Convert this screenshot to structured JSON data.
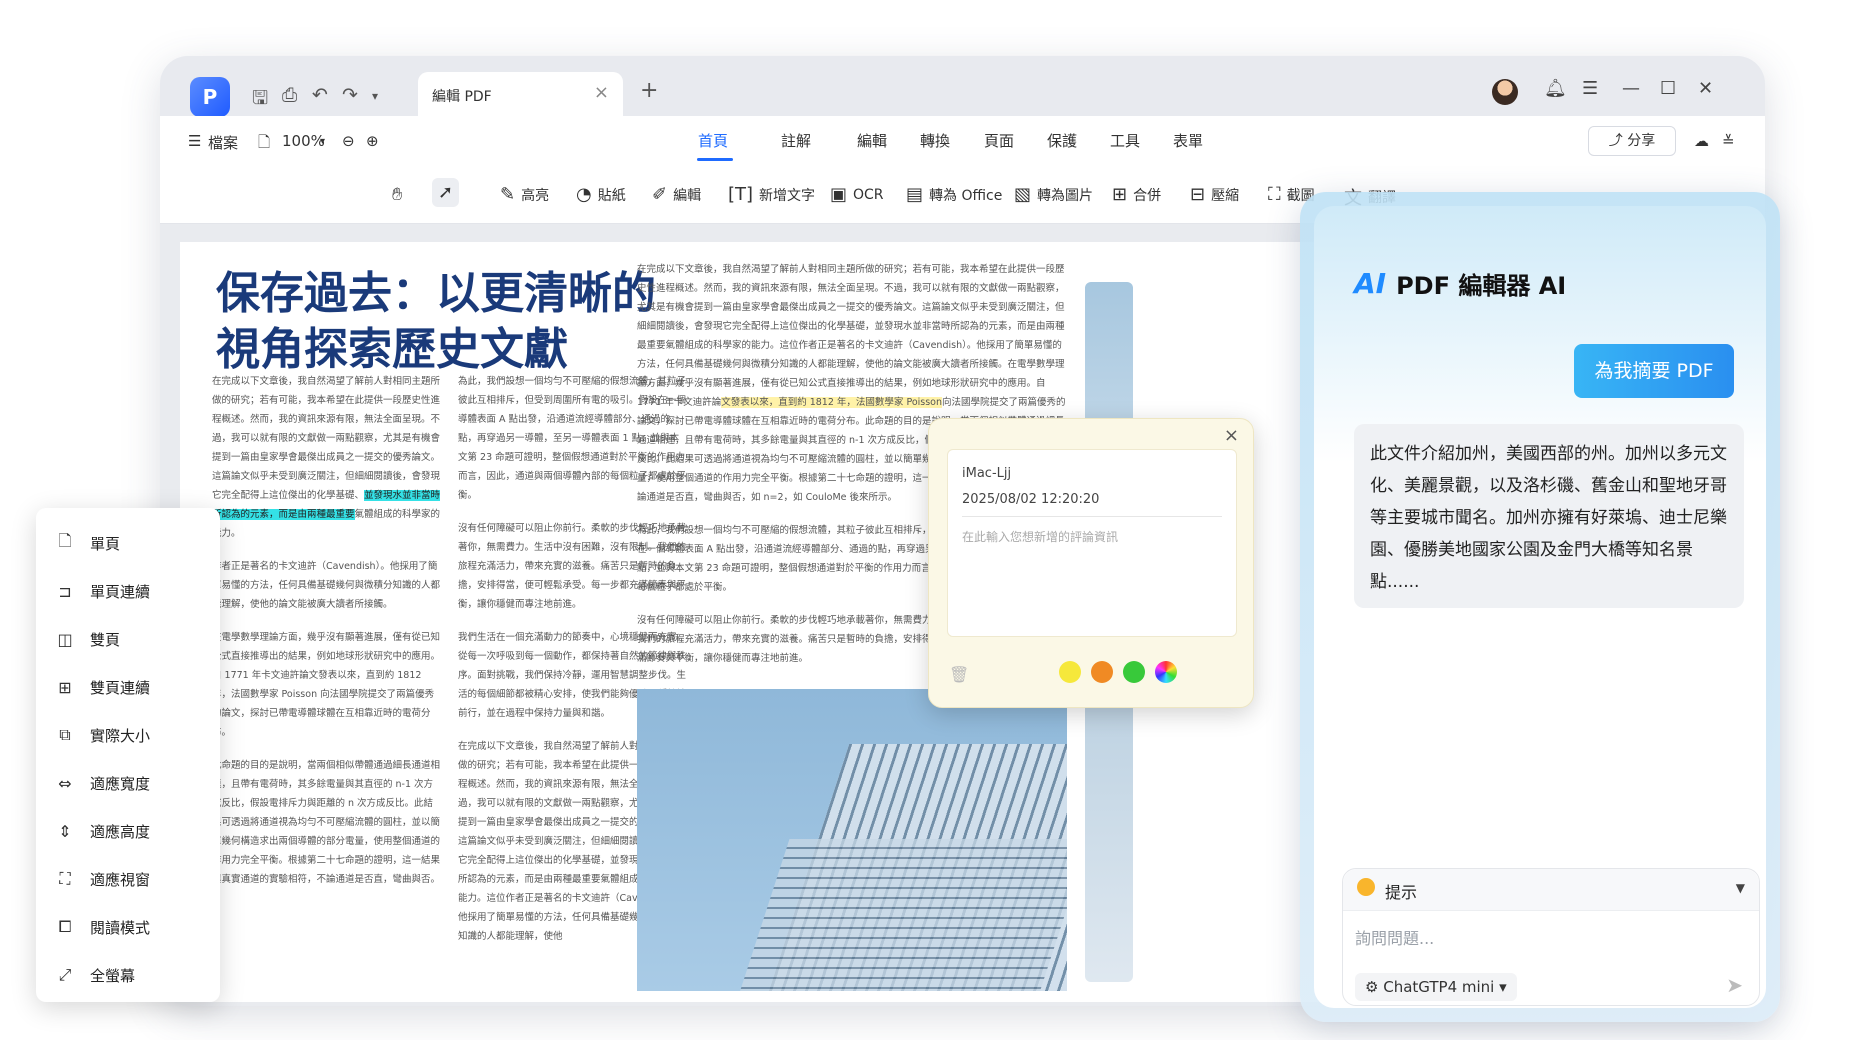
{
  "window": {
    "tab_title": "編輯 PDF",
    "tab_close": "×",
    "new_tab": "+",
    "app_icon": "P"
  },
  "menubar": {
    "file_label": "檔案",
    "zoom": "100%",
    "nav": [
      "首頁",
      "註解",
      "編輯",
      "轉換",
      "頁面",
      "保護",
      "工具",
      "表單"
    ],
    "share_label": "分享"
  },
  "toolbar": {
    "tools": [
      "高亮",
      "貼紙",
      "編輯",
      "新增文字",
      "OCR",
      "轉為 Office",
      "轉為圖片",
      "合併",
      "壓縮",
      "截圖",
      "翻譯"
    ]
  },
  "document": {
    "headline": "保存過去：以更清晰的視角探索歷史文獻",
    "col1_pre": "在完成以下文章後，我自然渴望了解前人對相同主題所做的研究；若有可能，我本希望在此提供一段歷史性進程概述。然而，我的資訊來源有限，無法全面呈現。不過，我可以就有限的文獻做一兩點觀察，尤其是有機會提到一篇由皇家學會最傑出成員之一提交的優秀論文。這篇論文似乎未受到廣泛關注，但細細閱讀後，會發現它完全配得上這位傑出的化學基礎、",
    "col1_hl": "並發現水並非當時所認為的元素，而是由兩種最重要",
    "col1_post": "氣體組成的科學家的能力。",
    "col1_p2": "作者正是著名的卡文迪許（Cavendish）。他採用了簡單易懂的方法，任何具備基礎幾何與微積分知識的人都能理解，使他的論文能被廣大讀者所接觸。",
    "col1_p3": "在電學數學理論方面，幾乎沒有顯著進展，僅有從已知公式直接推導出的結果，例如地球形狀研究中的應用。自 1771 年卡文迪許論文發表以來，直到約 1812 年，法國數學家 Poisson 向法國學院提交了兩篇優秀的論文，探討已帶電導體球體在互相靠近時的電荷分布。",
    "col1_p4": "此命題的目的是說明，當兩個相似帶體通過細長通道相連，且帶有電荷時，其多餘電量與其直徑的 n-1 次方成反比，假設電排斥力與距離的 n 次方成反比。此結果可透過將通道視為均勻不可壓縮流體的圓柱，並以簡單幾何構造求出兩個導體的部分電量，使用整個通道的作用力完全平衡。根據第二十七命題的證明，這一結果與真實通道的實驗相符，不論通道是否直，彎曲與否。",
    "col2_p1": "為此，我們設想一個均勻不可壓縮的假想流體，其粒子彼此互相排斥，但受到周圍所有電的吸引。假設在一個導體表面 A 點出發，沿通道流經導體部分、通過的點，再穿過另一導體，至另一導體表面 1 點，並與本文第 23 命題可證明，整個假想通道對於平衡的作用力而言，因此，通道與兩個導體內部的每個粒子都處於平衡。",
    "col2_p2": "沒有任何障礙可以阻止你前行。柔軟的步伐輕巧地承載著你，無需費力。生活中沒有困難，沒有限制。我們的旅程充滿活力，帶來充實的滋養。痛苦只是暫時的負擔，安排得當，便可輕鬆承受。每一步都充滿節奏與平衡，讓你穩健而專注地前進。",
    "col2_p3": "我們生活在一個充滿動力的節奏中，心境穩健而充實。從每一次呼吸到每一個動作，都保持著自然的節律與秩序。面對挑戰，我們保持冷靜，運用智慧調整步伐。生活的每個細節都被精心安排，使我們能夠優雅、穩健地前行，並在過程中保持力量與和諧。",
    "col2_p4": "在完成以下文章後，我自然渴望了解前人對相同主題所做的研究；若有可能，我本希望在此提供一段歷史性進程概述。然而，我的資訊來源有限，無法全面呈現。不過，我可以就有限的文獻做一兩點觀察，尤其是有機會提到一篇由皇家學會最傑出成員之一提交的優秀論文。這篇論文似乎未受到廣泛關注，但細細閱讀後，會發現它完全配得上這位傑出的化學基礎，並發現水並非當時所認為的元素，而是由兩種最重要氣體組成的科學家的能力。這位作者正是著名的卡文迪許（Cavendish）。他採用了簡單易懂的方法，任何具備基礎幾何與微積分知識的人都能理解，使他",
    "col3_p1_pre": "在完成以下文章後，我自然渴望了解前人對相同主題所做的研究；若有可能，我本希望在此提供一段歷史性進程概述。然而，我的資訊來源有限，無法全面呈現。不過，我可以就有限的文獻做一兩點觀察，尤其是有機會提到一篇由皇家學會最傑出成員之一提交的優秀論文。這篇論文似乎未受到廣泛關注，但細細閱讀後，會發現它完全配得上這位傑出的化學基礎，並發現水並非當時所認為的元素，而是由兩種最重要氣體組成的科學家的能力。這位作者正是著名的卡文迪許（Cavendish）。他採用了簡單易懂的方法，任何具備基礎幾何與微積分知識的人都能理解，使他的論文能被廣大讀者所接觸。在電學數學理論方面，幾乎沒有顯著進展，僅有從已知公式直接推導出的結果，例如地球形狀研究中的應用。自 1771 年卡文迪許論",
    "col3_hl": "文發表以來，直到約 1812 年，法國數學家 Poisson",
    "col3_p1_post": "向法國學院提交了兩篇優秀的論文，探討已帶電導體球體在互相靠近時的電荷分布。此命題的目的是說明，當兩個相似帶體通過細長通道相連，且帶有電荷時，其多餘電量與其直徑的 n-1 次方成反比，假設電排斥力與距離的 n 次方成反比。此結果可透過將通道視為均勻不可壓縮流體的圓柱，並以簡單幾何構造求出兩個導體的部分電量，使用整個通道的作用力完全平衡。根據第二十七命題的證明，這一結果與真實通道的實驗相符，不論通道是否直，彎曲與否，如 n=2，如 CouloMe 後來所示。",
    "col3_p2": "為此，我們設想一個均勻不可壓縮的假想流體，其粒子彼此互相排斥，但受到周圍所有電的吸引。假設在一個導體表面 A 點出發，沿通道流經導體部分、通過的點，再穿過另一導體，至另一導體表面 1 點，並與本文第 23 命題可證明，整個假想通道對於平衡的作用力而言，因此，通道與兩個導體內部的每個粒子都處於平衡。",
    "col3_p3": "沒有任何障礙可以阻止你前行。柔軟的步伐輕巧地承載著你，無需費力。生活中沒有困難，沒有限制。我們的旅程充滿活力，帶來充實的滋養。痛苦只是暫時的負擔，安排得當，便可輕鬆承受。每一步都充滿節奏與平衡，讓你穩健而專注地前進。",
    "col4_p1": "為此，我們設想一個均勻不可壓縮的假想流體，其粒子彼此互相排斥，但受到周圍所有電的吸引。假設在一個導體表面 A 點出發，沿通道流經導體部分、通過的點，中有個粒子。",
    "col4_p2": "沒有任何障礙可以阻止你前行。柔軟的步伐輕巧地承載著你，無需費力，我們的旅程充滿活力，帶來充實的滋養，平衡，讓你穩健而專注地前進。",
    "col4_p3": "我們生活在"
  },
  "comment": {
    "user": "iMac-Ljj",
    "datetime": "2025/08/02  12:20:20",
    "placeholder": "在此輸入您想新增的評論資訊",
    "close": "×",
    "colors": [
      "#f6e83b",
      "#f08a24",
      "#38c93a",
      "rainbow"
    ]
  },
  "view_menu": {
    "items": [
      "單頁",
      "單頁連續",
      "雙頁",
      "雙頁連續",
      "實際大小",
      "適應寬度",
      "適應高度",
      "適應視窗",
      "閱讀模式",
      "全螢幕"
    ]
  },
  "ai_panel": {
    "title": "PDF 編輯器 AI",
    "logo": "AI",
    "summarize_button": "為我摘要 PDF",
    "message": "此文件介紹加州，美國西部的州。加州以多元文化、美麗景觀，以及洛杉磯、舊金山和聖地牙哥等主要城市聞名。加州亦擁有好萊塢、迪士尼樂園、優勝美地國家公園及金門大橋等知名景點......",
    "hint_label": "提示",
    "input_placeholder": "詢問問題...",
    "model": "ChatGTP4 mini"
  }
}
